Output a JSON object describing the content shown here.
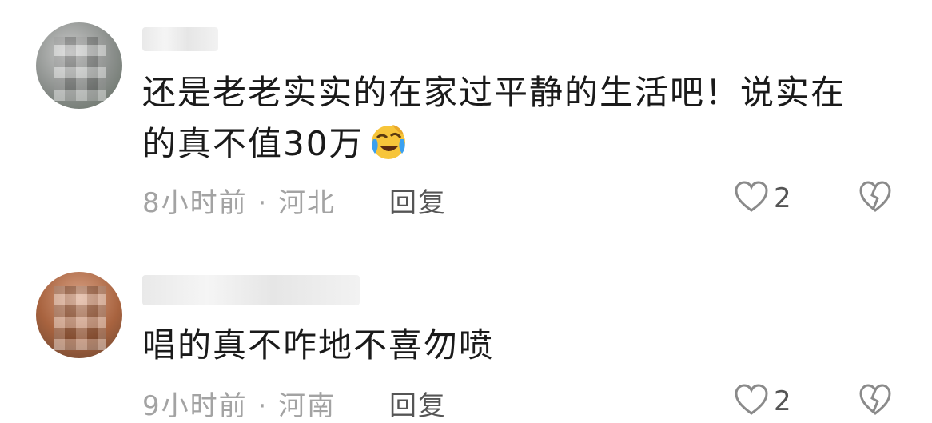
{
  "comments": [
    {
      "text_line1": "还是老老实实的在家过平静的生活吧！说实在",
      "text_line2": "的真不值30万",
      "emoji": "laughing-crying-emoji",
      "meta": "8小时前 · 河北",
      "reply_label": "回复",
      "like_count": "2"
    },
    {
      "text_line1": "唱的真不咋地不喜勿喷",
      "meta": "9小时前 · 河南",
      "reply_label": "回复",
      "like_count": "2"
    }
  ],
  "icons": {
    "like": "heart-outline-icon",
    "dislike": "broken-heart-icon"
  },
  "colors": {
    "text": "#1a1a1a",
    "meta": "#a3a3a3",
    "emoji_face": "#f7c53a",
    "emoji_tears": "#3aa0f0"
  }
}
